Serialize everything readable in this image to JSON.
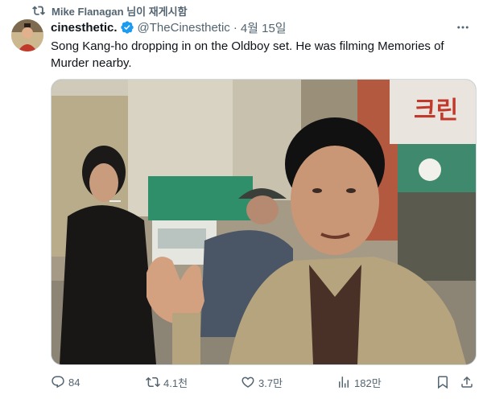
{
  "repost": {
    "icon": "repost-icon",
    "label": "Mike Flanagan 님이 재게시함"
  },
  "author": {
    "display_name": "cinesthetic.",
    "handle": "@TheCinesthetic",
    "separator": "·",
    "time": "4월 15일",
    "avatar_icon": "avatar-image"
  },
  "tweet": {
    "text": "Song Kang-ho dropping in on the Oldboy set. He was filming Memories of Murder nearby.",
    "media_sign_text": "크린"
  },
  "actions": {
    "replies": "84",
    "reposts": "4.1천",
    "likes": "3.7만",
    "views": "182만"
  },
  "colors": {
    "text": "#0f1419",
    "secondary": "#536471",
    "verified": "#1d9bf0"
  }
}
